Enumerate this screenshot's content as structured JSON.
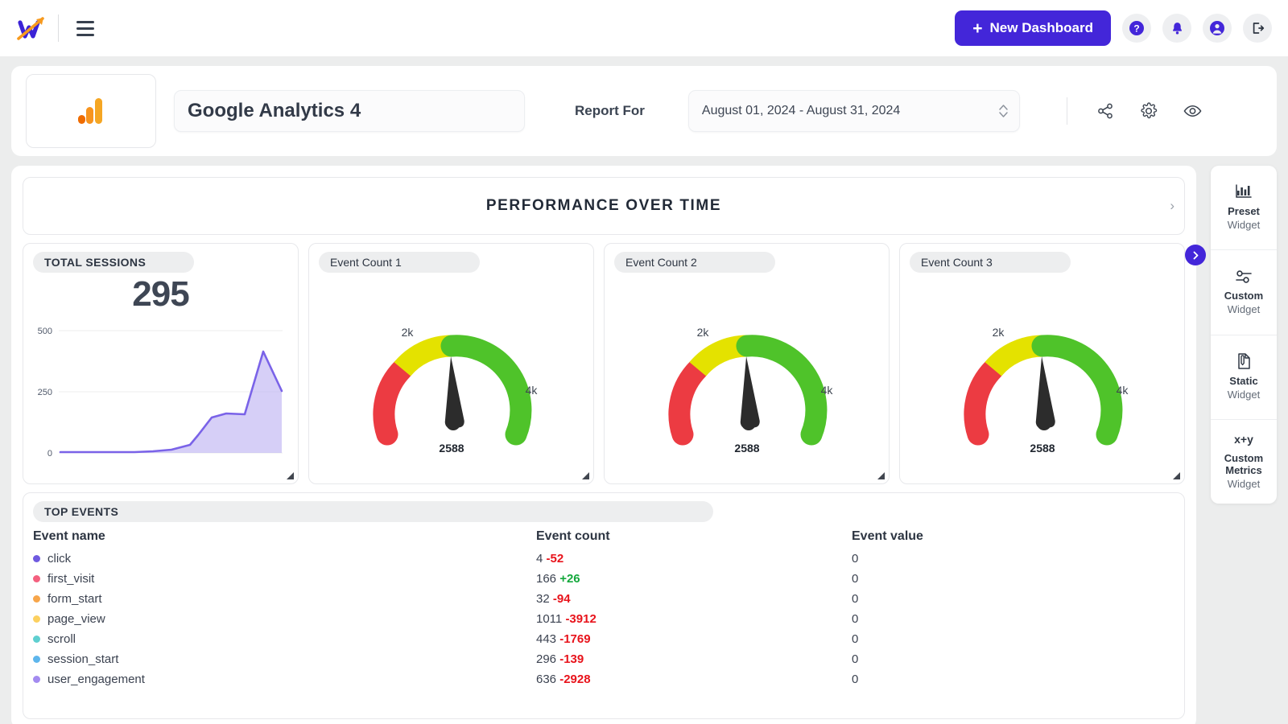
{
  "brand": {
    "logo_icon": "w-arrow-logo",
    "accent_color": "#4326d9"
  },
  "topnav": {
    "menu_icon": "hamburger-menu-icon",
    "new_dashboard_label": "New Dashboard",
    "plus_glyph": "+",
    "icons": [
      {
        "name": "help-icon",
        "glyph": "?"
      },
      {
        "name": "notifications-bell-icon",
        "glyph": "\u0000"
      },
      {
        "name": "account-icon",
        "glyph": "\u0000"
      },
      {
        "name": "logout-icon",
        "glyph": "\u0000"
      }
    ]
  },
  "report_header": {
    "source_logo": "google-analytics-logo",
    "dashboard_title": "Google Analytics 4",
    "report_for_label": "Report For",
    "date_range": "August 01, 2024 - August 31, 2024",
    "actions": [
      {
        "name": "share-icon"
      },
      {
        "name": "settings-gear-icon"
      },
      {
        "name": "preview-eye-icon"
      }
    ]
  },
  "performance_banner": {
    "title": "PERFORMANCE OVER TIME",
    "expand_glyph": "›"
  },
  "sessions_card": {
    "title": "TOTAL SESSIONS",
    "value": "295"
  },
  "gauges": [
    {
      "title": "Event Count 1",
      "value": "2588",
      "min_label": "2k",
      "max_label": "4k"
    },
    {
      "title": "Event Count 2",
      "value": "2588",
      "min_label": "2k",
      "max_label": "4k"
    },
    {
      "title": "Event Count 3",
      "value": "2588",
      "min_label": "2k",
      "max_label": "4k"
    }
  ],
  "top_events": {
    "title": "TOP EVENTS",
    "columns": [
      "Event name",
      "Event count",
      "Event value"
    ],
    "rows": [
      {
        "name": "click",
        "dot": "#6f5ae0",
        "count": "4",
        "delta": "-52",
        "delta_dir": "neg",
        "value": "0"
      },
      {
        "name": "first_visit",
        "dot": "#f4607f",
        "count": "166",
        "delta": "+26",
        "delta_dir": "pos",
        "value": "0"
      },
      {
        "name": "form_start",
        "dot": "#f7a64a",
        "count": "32",
        "delta": "-94",
        "delta_dir": "neg",
        "value": "0"
      },
      {
        "name": "page_view",
        "dot": "#fcd060",
        "count": "1011",
        "delta": "-3912",
        "delta_dir": "neg",
        "value": "0"
      },
      {
        "name": "scroll",
        "dot": "#5fcfd0",
        "count": "443",
        "delta": "-1769",
        "delta_dir": "neg",
        "value": "0"
      },
      {
        "name": "session_start",
        "dot": "#5eb6ec",
        "count": "296",
        "delta": "-139",
        "delta_dir": "neg",
        "value": "0"
      },
      {
        "name": "user_engagement",
        "dot": "#a38bf0",
        "count": "636",
        "delta": "-2928",
        "delta_dir": "neg",
        "value": "0"
      }
    ]
  },
  "widget_panel": {
    "toggle_glyph": "❯",
    "items": [
      {
        "icon": "bar-chart-icon",
        "line1": "Preset",
        "line2": "Widget"
      },
      {
        "icon": "sliders-icon",
        "line1": "Custom",
        "line2": "Widget"
      },
      {
        "icon": "document-edit-icon",
        "line1": "Static",
        "line2": "Widget"
      },
      {
        "icon": "xy-formula-icon",
        "glyph": "x+y",
        "line1": "Custom Metrics",
        "line2": "Widget"
      }
    ]
  },
  "chart_data": [
    {
      "type": "area",
      "title": "TOTAL SESSIONS",
      "total": 295,
      "ylabel": "",
      "xlabel": "",
      "ylim": [
        0,
        500
      ],
      "yticks": [
        0,
        250,
        500
      ],
      "grid": true,
      "x": [
        1,
        2,
        3,
        4,
        5,
        6,
        7,
        8,
        9,
        10,
        11,
        12,
        13
      ],
      "values": [
        3,
        3,
        3,
        3,
        4,
        5,
        6,
        30,
        70,
        128,
        150,
        450,
        295
      ]
    },
    {
      "type": "gauge",
      "title": "Event Count 1",
      "value": 2588,
      "min": 0,
      "max": 6000,
      "tick_labels": [
        "2k",
        "4k"
      ],
      "bands": [
        {
          "color": "#ec3b42",
          "from": 0,
          "to": 1600
        },
        {
          "color": "#e4e200",
          "from": 1600,
          "to": 3000
        },
        {
          "color": "#4fc32a",
          "from": 3000,
          "to": 6000
        }
      ]
    },
    {
      "type": "gauge",
      "title": "Event Count 2",
      "value": 2588,
      "min": 0,
      "max": 6000,
      "tick_labels": [
        "2k",
        "4k"
      ],
      "bands": [
        {
          "color": "#ec3b42",
          "from": 0,
          "to": 1600
        },
        {
          "color": "#e4e200",
          "from": 1600,
          "to": 3000
        },
        {
          "color": "#4fc32a",
          "from": 3000,
          "to": 6000
        }
      ]
    },
    {
      "type": "gauge",
      "title": "Event Count 3",
      "value": 2588,
      "min": 0,
      "max": 6000,
      "tick_labels": [
        "2k",
        "4k"
      ],
      "bands": [
        {
          "color": "#ec3b42",
          "from": 0,
          "to": 1600
        },
        {
          "color": "#e4e200",
          "from": 1600,
          "to": 3000
        },
        {
          "color": "#4fc32a",
          "from": 3000,
          "to": 6000
        }
      ]
    },
    {
      "type": "table",
      "title": "TOP EVENTS",
      "columns": [
        "Event name",
        "Event count",
        "Event value"
      ],
      "rows": [
        [
          "click",
          4,
          -52,
          0
        ],
        [
          "first_visit",
          166,
          26,
          0
        ],
        [
          "form_start",
          32,
          -94,
          0
        ],
        [
          "page_view",
          1011,
          -3912,
          0
        ],
        [
          "scroll",
          443,
          -1769,
          0
        ],
        [
          "session_start",
          296,
          -139,
          0
        ],
        [
          "user_engagement",
          636,
          -2928,
          0
        ]
      ]
    }
  ]
}
